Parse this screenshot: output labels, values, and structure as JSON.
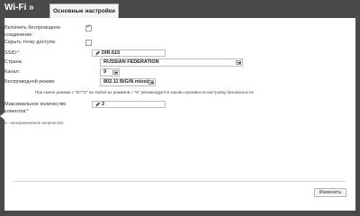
{
  "header": {
    "section_title": "Wi-Fi »",
    "tab_label": "Основные настройки"
  },
  "form": {
    "enable_wireless": {
      "label": "Включить беспроводное соединение:",
      "checked": true
    },
    "hide_ap": {
      "label": "Скрыть точку доступа:",
      "checked": false
    },
    "ssid": {
      "label": "SSID:",
      "required_mark": "*",
      "value": "DIR.615"
    },
    "country": {
      "label": "Страна:",
      "value": "RUSSIAN FEDERATION"
    },
    "channel": {
      "label": "Канал:",
      "value": "9"
    },
    "mode": {
      "label": "Беспроводной режим:",
      "value": "802.11 B/G/N mixed"
    },
    "mode_note": "При смене режима с \"B\"/\"G\" на любой из режимов с \"N\" рекомендуется заново произвести настройку безопасности!",
    "max_clients": {
      "label": "Максимальное количество клиентов:",
      "required_mark": "*",
      "value": "2"
    },
    "max_clients_hint": "0 - неограниченное количество"
  },
  "buttons": {
    "change_label": "Изменить"
  },
  "icons": {
    "back": "chevron-left-icon",
    "edit": "pencil-icon",
    "dropdown": "dropdown-arrow-icon"
  },
  "colors": {
    "chrome": "#4a4a4a",
    "required": "#cc0000"
  }
}
